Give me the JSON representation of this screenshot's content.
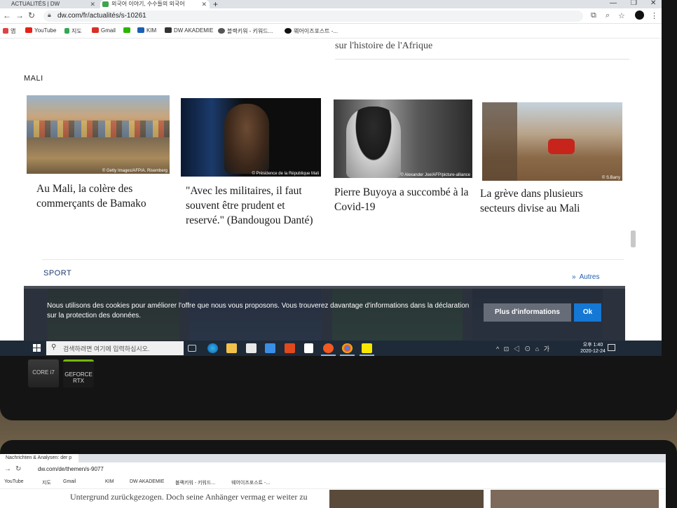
{
  "laptop1": {
    "tabs": [
      {
        "label": "ACTUALITÉS | DW"
      },
      {
        "label": "외국어 이야기, 수수들의 외국어"
      }
    ],
    "address_url": "dw.com/fr/actualités/s-10261",
    "bookmarks": [
      "앱",
      "YouTube",
      "지도",
      "Gmail",
      "",
      "KIM",
      "DW AKADEMIE",
      "블랙키워 - 키워드...",
      "웨어이즈포스트 -..."
    ],
    "previous_text": "sur l'histoire de l'Afrique",
    "section_title": "MALI",
    "articles": [
      {
        "headline": "Au Mali, la colère des commerçants de Bamako",
        "credit": "© Getty Images/AFP/A. Risemberg"
      },
      {
        "headline": "\"Avec les militaires, il faut souvent être prudent et reservé.\" (Bandougou Danté)",
        "credit": "© Présidence de la République Mali"
      },
      {
        "headline": "Pierre Buyoya a succombé à la Covid-19",
        "credit": "© Alexander Joe/AFP/picture-alliance"
      },
      {
        "headline": "La grève dans plusieurs secteurs divise au Mali",
        "credit": "© S.Barry"
      }
    ],
    "sport_section": "SPORT",
    "more_link": "Autres",
    "cookie": {
      "text": "Nous utilisons des cookies pour améliorer l'offre que nous vous proposons. Vous trouverez davantage d'informations dans la déclaration sur la protection des données.",
      "info_button": "Plus d'informations",
      "ok_button": "Ok"
    },
    "taskbar": {
      "search_placeholder": "검색하려면 여기에 입력하십시오.",
      "time": "오후 1:40",
      "date": "2020-12-24",
      "tray": "^ ⊡ ◁ ⊙ ⌂ 가"
    },
    "stickers": {
      "intel": "CORE i7",
      "nvidia": "GEFORCE RTX"
    }
  },
  "laptop2": {
    "tab": "Nachrichten & Analysen: der p",
    "address_url": "dw.com/de/themen/s-9077",
    "bookmarks": [
      "YouTube",
      "지도",
      "Gmail",
      "KIM",
      "DW AKADEMIE",
      "블랙키워 - 키워드...",
      "웨어이즈포스트 -..."
    ],
    "article_text": "Untergrund zurückgezogen. Doch seine Anhänger vermag er weiter zu"
  }
}
